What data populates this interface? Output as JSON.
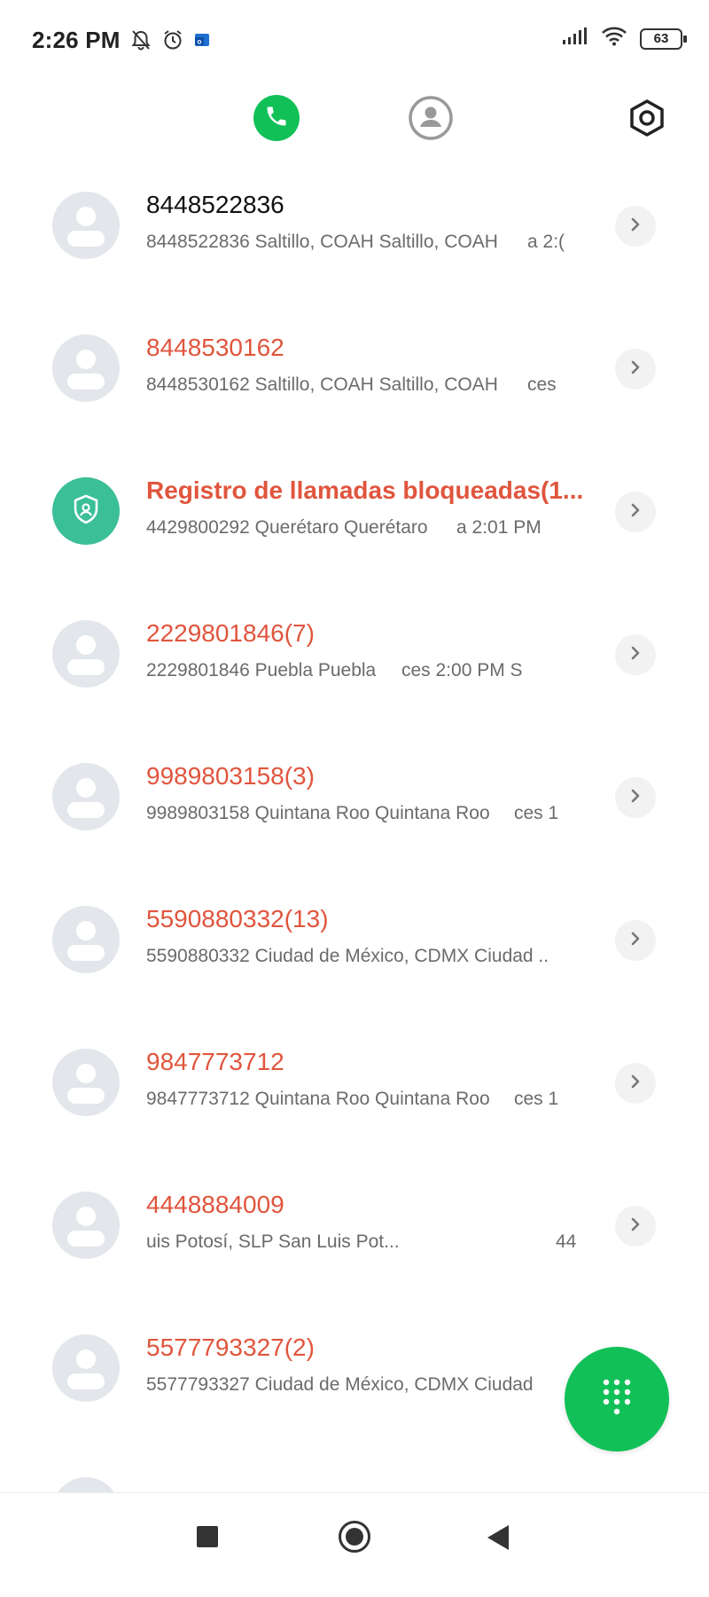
{
  "status_bar": {
    "time": "2:26 PM",
    "battery": "63",
    "icons": [
      "bell-off-icon",
      "alarm-icon",
      "outlook-icon",
      "signal-icon",
      "wifi-icon",
      "battery-icon"
    ]
  },
  "top_nav": {
    "tabs": [
      "phone-icon",
      "contacts-icon",
      "settings-icon"
    ],
    "active_color": "#11c157"
  },
  "calls": [
    {
      "name": "8448522836",
      "detail": "8448522836 Saltillo, COAH Saltillo, COAH",
      "time_frag": "a   2:(",
      "missed": false
    },
    {
      "name": "8448530162",
      "detail": "8448530162 Saltillo, COAH Saltillo, COAH",
      "time_frag": "ces",
      "missed": true
    },
    {
      "name": "Registro de llamadas bloqueadas(1...",
      "detail": "4429800292 Querétaro Querétaro",
      "time_frag": "a          2:01 PM",
      "missed": true
    },
    {
      "name": "2229801846(7)",
      "detail": "2229801846 Puebla Puebla",
      "time_frag": "ces            2:00 PM S",
      "missed": true
    },
    {
      "name": "9989803158(3)",
      "detail": "9989803158 Quintana Roo Quintana Roo",
      "time_frag": "ces    1",
      "missed": true
    },
    {
      "name": "5590880332(13)",
      "detail": "5590880332 Ciudad de México, CDMX Ciudad ..",
      "time_frag": "",
      "missed": true
    },
    {
      "name": "9847773712",
      "detail": "9847773712 Quintana Roo Quintana Roo",
      "time_frag": "ces    1",
      "missed": true
    },
    {
      "name": "4448884009",
      "detail": "uis Potosí, SLP San Luis Pot...",
      "time_frag": "44",
      "missed": true
    },
    {
      "name": "5577793327(2)",
      "detail": "5577793327 Ciudad de México, CDMX Ciudad",
      "time_frag": "",
      "missed": true
    }
  ],
  "colors": {
    "missed": "#e0553d",
    "normal": "#111111",
    "accent": "#11c157",
    "blocked_avatar": "#3bbf97"
  }
}
